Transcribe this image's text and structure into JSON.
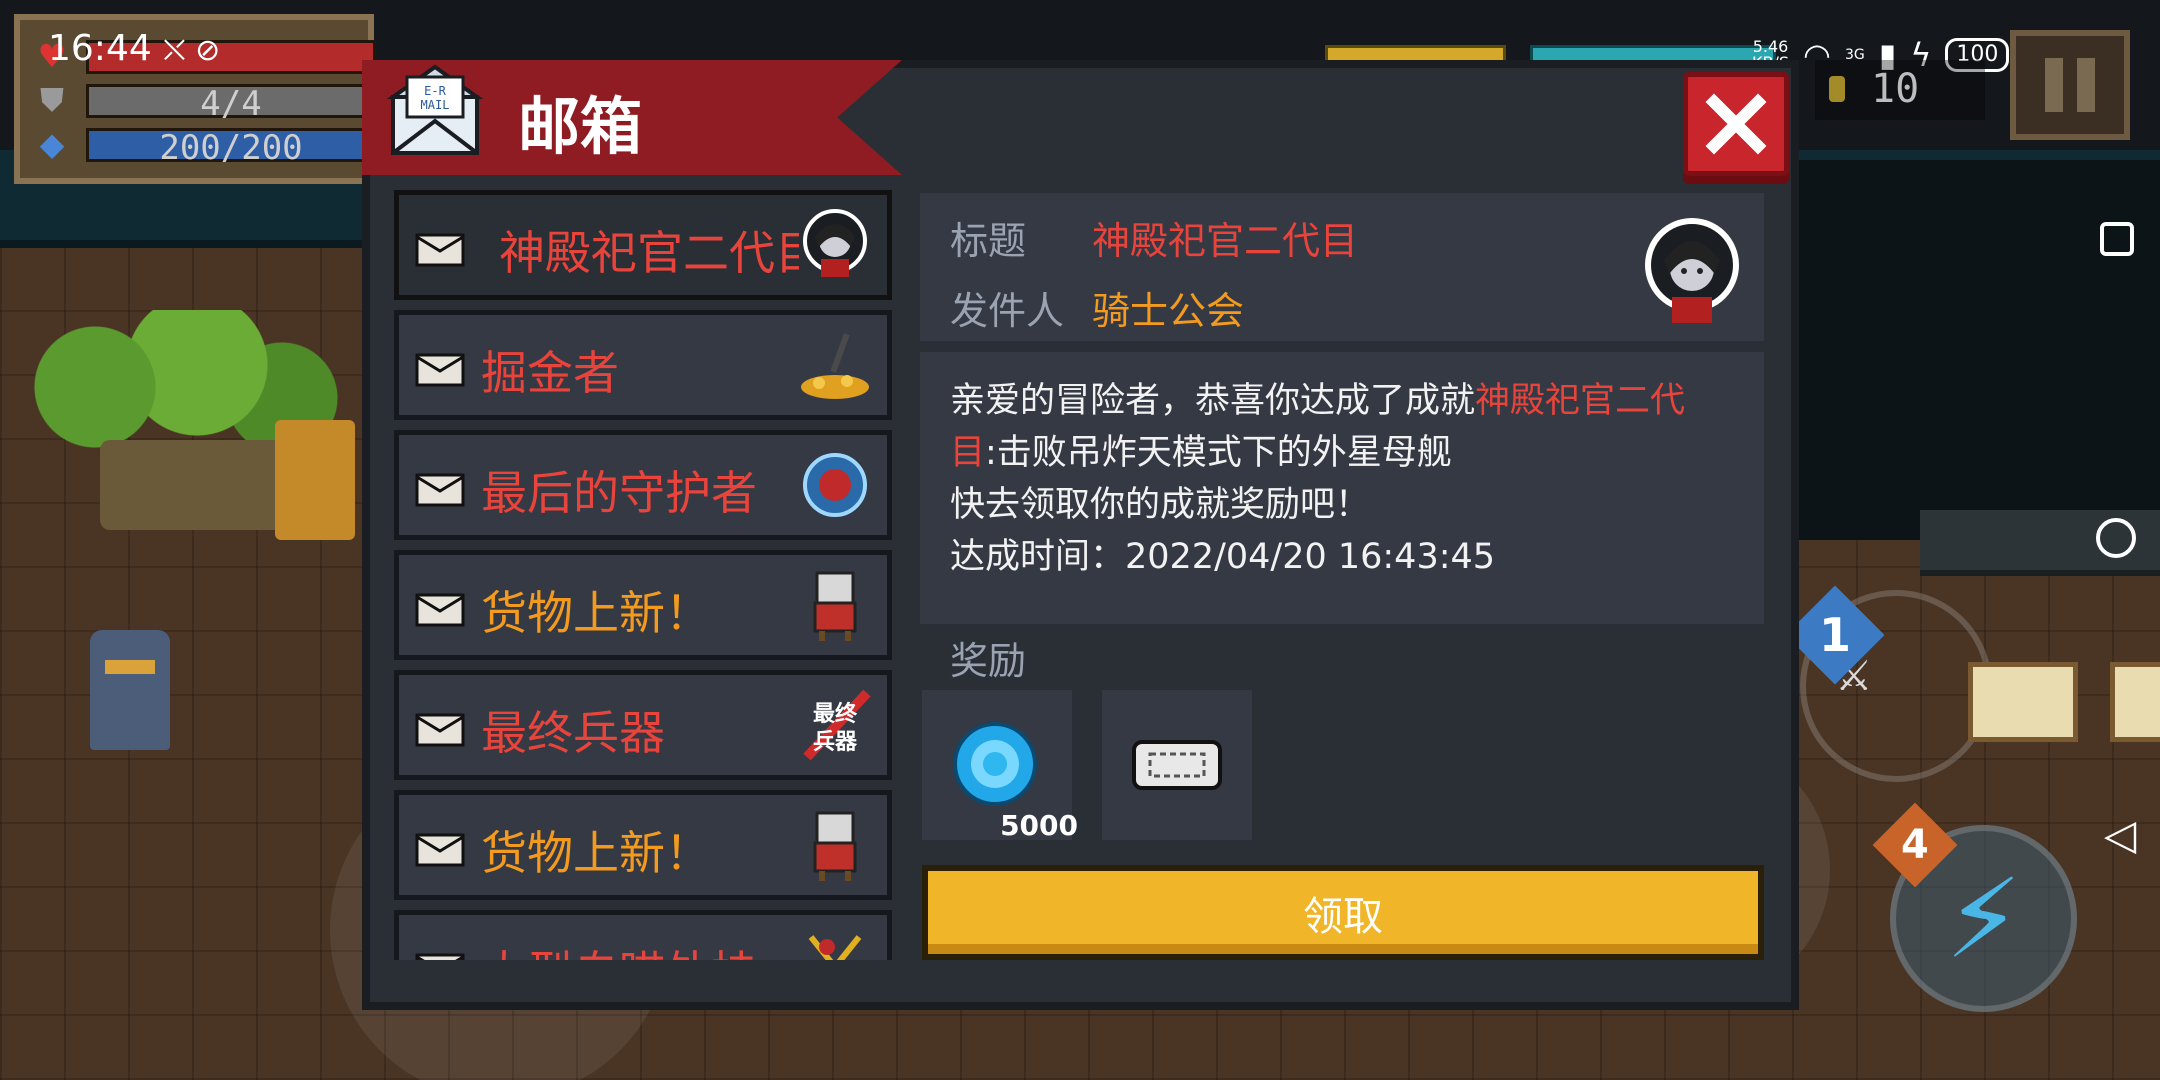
{
  "status_bar": {
    "time": "16:44",
    "net_speed_value": "5.46",
    "net_speed_unit": "KB/S",
    "network_type": "3G",
    "battery": "100"
  },
  "hud": {
    "hp_label": "",
    "armor": "4/4",
    "energy": "200/200"
  },
  "coins": "10",
  "dialog": {
    "title": "邮箱",
    "close_icon": "close-icon"
  },
  "mail_list": [
    {
      "subject": "神殿祀官二代目",
      "color": "red",
      "thumb": "priest-avatar"
    },
    {
      "subject": "掘金者",
      "color": "red",
      "thumb": "gold-shovel"
    },
    {
      "subject": "最后的守护者",
      "color": "red",
      "thumb": "guardian-orb"
    },
    {
      "subject": "货物上新！",
      "color": "orange",
      "thumb": "merchant"
    },
    {
      "subject": "最终兵器",
      "color": "red",
      "thumb": "ultimate-weapon"
    },
    {
      "subject": "货物上新！",
      "color": "orange",
      "thumb": "merchant"
    },
    {
      "subject": "大型自瞄外挂",
      "color": "red",
      "thumb": "aim-bot"
    }
  ],
  "detail": {
    "title_label": "标题",
    "title_value": "神殿祀官二代目",
    "sender_label": "发件人",
    "sender_value": "骑士公会",
    "message_line1_prefix": "亲爱的冒险者，恭喜你达成了成就",
    "message_line1_highlight": "神殿祀官二代",
    "message_line2_highlight": "目",
    "message_line2_rest": ":击败吊炸天模式下的外星母舰",
    "message_line3": "快去领取你的成就奖励吧！",
    "message_line4": "达成时间：2022/04/20 16:43:45",
    "rewards_label": "奖励",
    "rewards": [
      {
        "icon": "blue-gem-icon",
        "count": "5000"
      },
      {
        "icon": "ticket-icon",
        "count": ""
      }
    ],
    "claim_button": "领取"
  },
  "colors": {
    "accent_red": "#e8443c",
    "accent_orange": "#f39a1f",
    "claim_yellow": "#f0b528",
    "banner_red": "#8f1c22"
  },
  "game": {
    "badge_1": "1",
    "badge_4": "4",
    "skill_icon": "lightning-icon"
  }
}
